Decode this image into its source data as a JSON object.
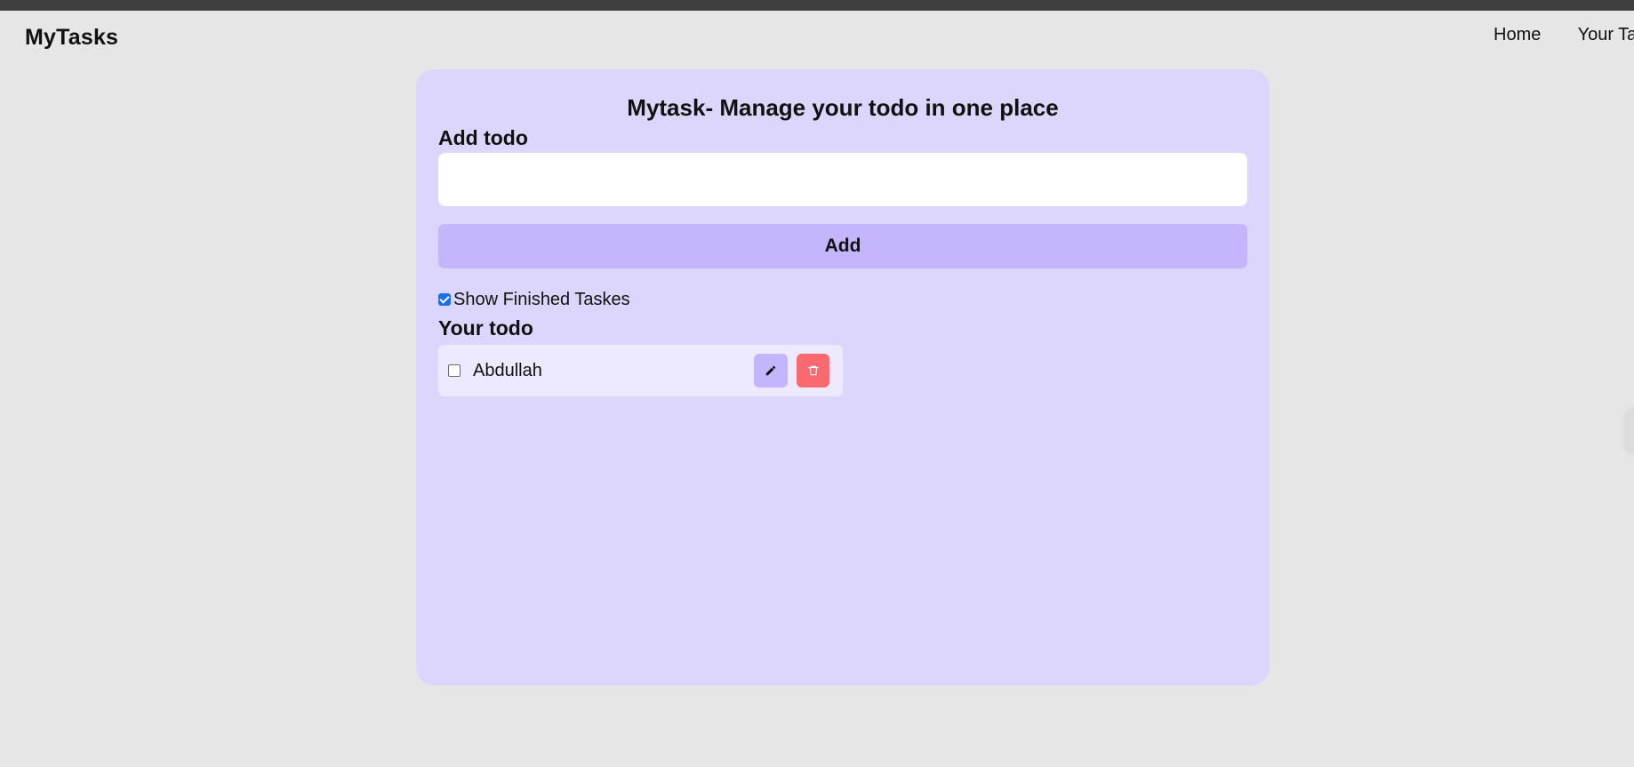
{
  "navbar": {
    "brand": "MyTasks",
    "links": [
      "Home",
      "Your Tasks"
    ]
  },
  "main": {
    "title": "Mytask- Manage your todo in one place",
    "add_label": "Add todo",
    "input": {
      "value": "",
      "placeholder": ""
    },
    "add_button": "Add",
    "show_finished": {
      "label": "Show Finished Taskes",
      "checked": true
    },
    "list_label": "Your todo",
    "todos": [
      {
        "text": "Abdullah",
        "done": false
      }
    ]
  },
  "colors": {
    "page_bg": "#e6e6e6",
    "card_bg": "#dcd6fd",
    "accent": "#c4b5fd",
    "item_bg": "#ede9fe",
    "delete": "#f86a6f",
    "checkbox": "#1a6ee8"
  },
  "icons": {
    "edit": "pencil-icon",
    "delete": "trash-icon"
  }
}
